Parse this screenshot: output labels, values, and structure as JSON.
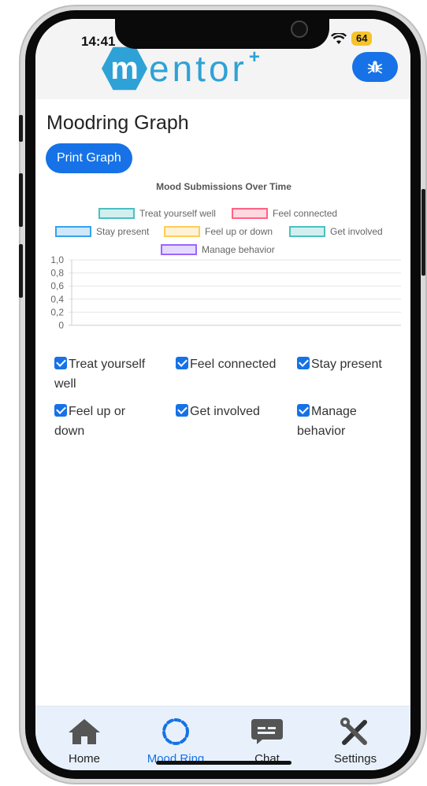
{
  "status_bar": {
    "time": "14:41",
    "battery": "64"
  },
  "header": {
    "logo_letter": "m",
    "logo_text": "entor",
    "logo_plus": "+"
  },
  "page": {
    "title": "Moodring Graph",
    "print_button": "Print Graph"
  },
  "colors": {
    "accent": "#1672e6",
    "brand": "#2ea2d6",
    "teal": "#4bc0c0",
    "pink": "#ff6384",
    "blue": "#36a2eb",
    "yellow": "#ffcd56",
    "purple": "#9966ff"
  },
  "chart_data": {
    "type": "line",
    "title": "Mood Submissions Over Time",
    "x": [],
    "ylim": [
      0,
      1
    ],
    "yticks": [
      "1,0",
      "0,8",
      "0,6",
      "0,4",
      "0,2",
      "0"
    ],
    "legend_position": "top",
    "grid": true,
    "series": [
      {
        "name": "Treat yourself well",
        "color": "#4bc0c0",
        "values": []
      },
      {
        "name": "Feel connected",
        "color": "#ff6384",
        "values": []
      },
      {
        "name": "Stay present",
        "color": "#36a2eb",
        "values": []
      },
      {
        "name": "Feel up or down",
        "color": "#ffcd56",
        "values": []
      },
      {
        "name": "Get involved",
        "color": "#4bc0c0",
        "values": []
      },
      {
        "name": "Manage behavior",
        "color": "#9966ff",
        "values": []
      }
    ]
  },
  "filters": [
    {
      "label": "Treat yourself well",
      "checked": true
    },
    {
      "label": "Feel connected",
      "checked": true
    },
    {
      "label": "Stay present",
      "checked": true
    },
    {
      "label": "Feel up or down",
      "checked": true
    },
    {
      "label": "Get involved",
      "checked": true
    },
    {
      "label": "Manage behavior",
      "checked": true
    }
  ],
  "nav": [
    {
      "label": "Home",
      "icon": "home-icon",
      "active": false
    },
    {
      "label": "Mood Ring",
      "icon": "mood-ring-icon",
      "active": true
    },
    {
      "label": "Chat",
      "icon": "chat-icon",
      "active": false
    },
    {
      "label": "Settings",
      "icon": "settings-icon",
      "active": false
    }
  ]
}
